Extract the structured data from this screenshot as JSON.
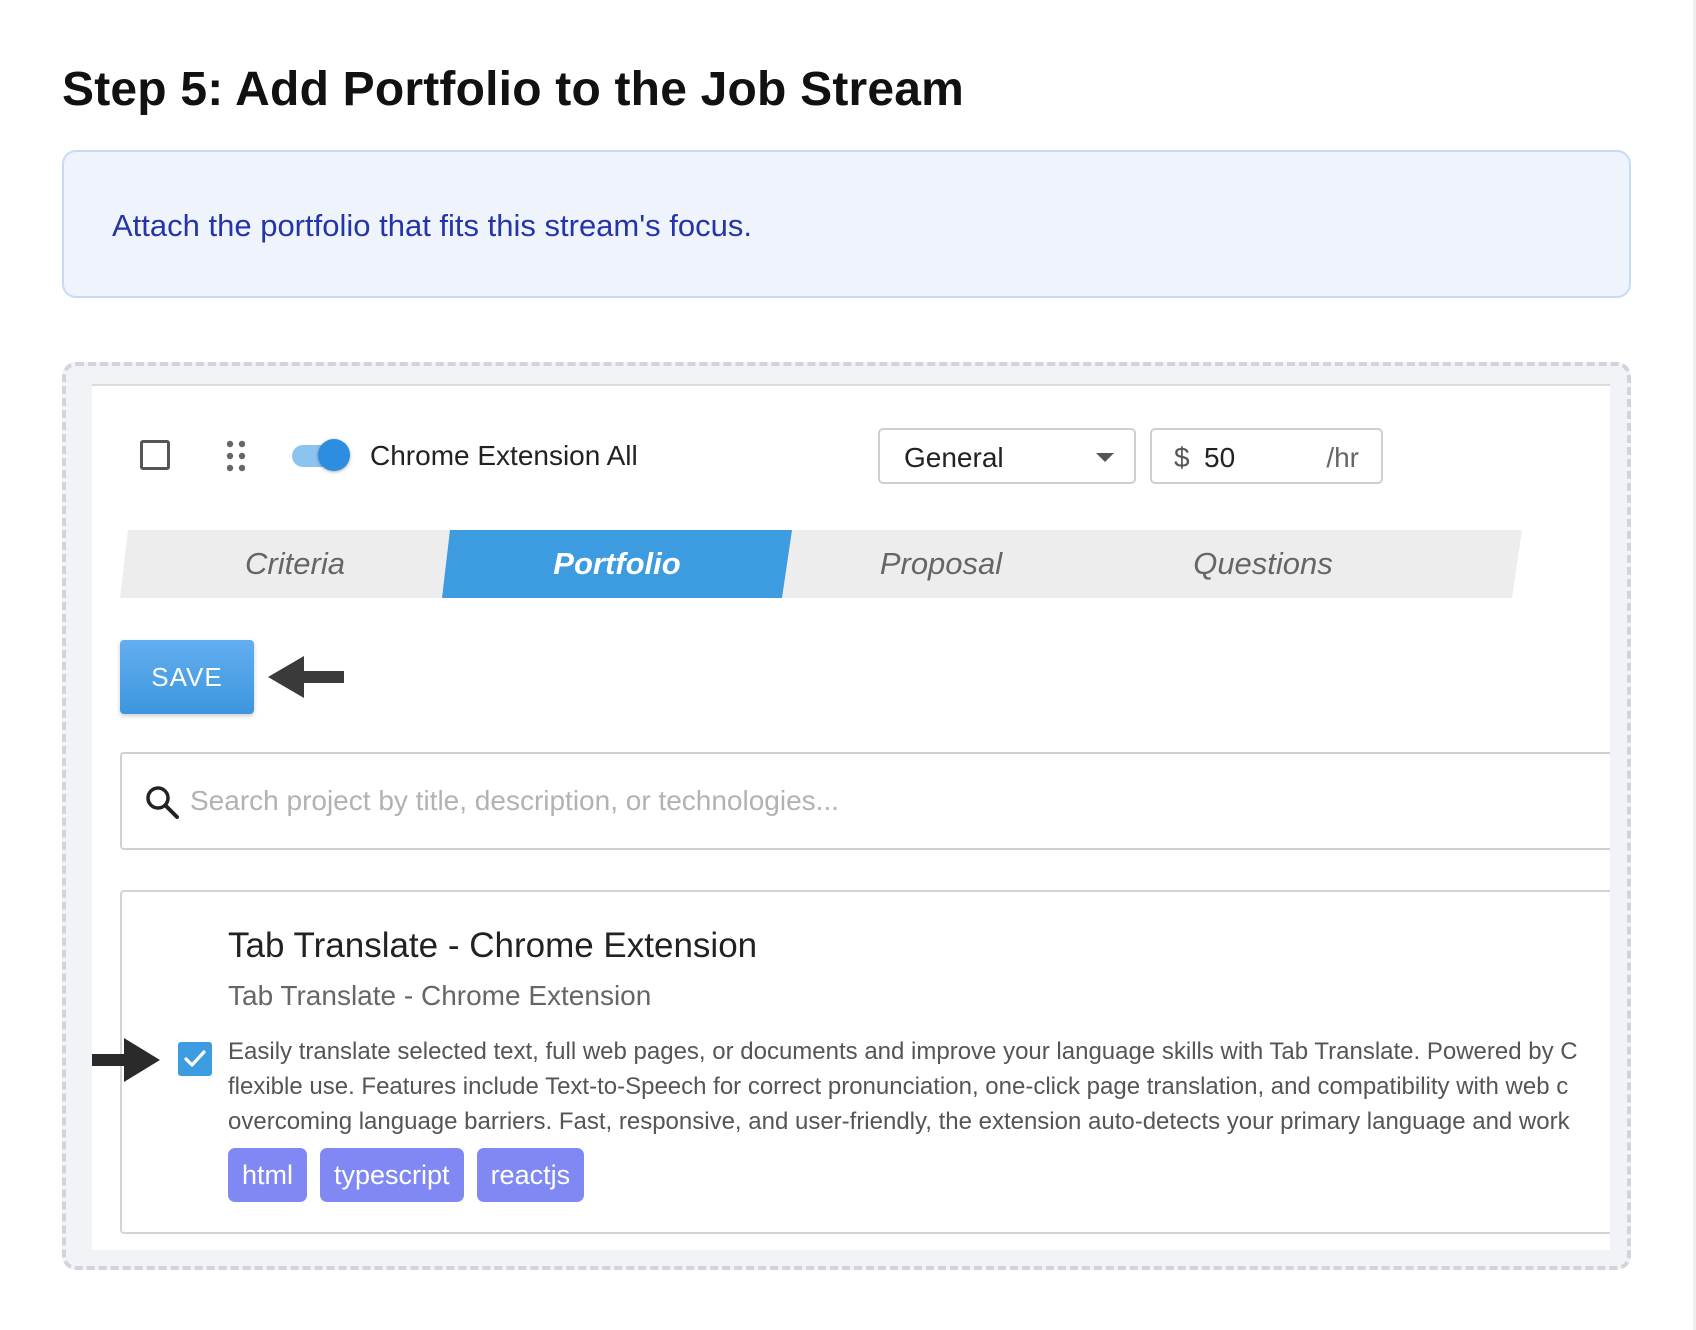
{
  "step": {
    "title": "Step 5: Add Portfolio to the Job Stream"
  },
  "info": {
    "text": "Attach the portfolio that fits this stream's focus."
  },
  "stream": {
    "name": "Chrome Extension All",
    "enabled": true,
    "category": "General",
    "rate_currency": "$",
    "rate_value": "50",
    "rate_unit": "/hr"
  },
  "tabs": [
    {
      "label": "Criteria",
      "active": false
    },
    {
      "label": "Portfolio",
      "active": true
    },
    {
      "label": "Proposal",
      "active": false
    },
    {
      "label": "Questions",
      "active": false
    }
  ],
  "toolbar": {
    "save_label": "SAVE"
  },
  "search": {
    "placeholder": "Search project by title, description, or technologies...",
    "value": ""
  },
  "project": {
    "title": "Tab Translate - Chrome Extension",
    "subtitle": "Tab Translate - Chrome Extension",
    "checked": true,
    "description_lines": [
      "Easily translate selected text, full web pages, or documents and improve your language skills with Tab Translate. Powered by C",
      "flexible use. Features include Text-to-Speech for correct pronunciation, one-click page translation, and compatibility with web c",
      "overcoming language barriers. Fast, responsive, and user-friendly, the extension auto-detects your primary language and work"
    ],
    "tags": [
      "html",
      "typescript",
      "reactjs"
    ]
  },
  "colors": {
    "accent": "#3d9be0",
    "info_text": "#2535a8",
    "tag": "#8088f4"
  },
  "icons": [
    "drag-handle-icon",
    "search-icon",
    "check-icon",
    "arrow-left-icon",
    "arrow-right-icon",
    "caret-down-icon"
  ]
}
